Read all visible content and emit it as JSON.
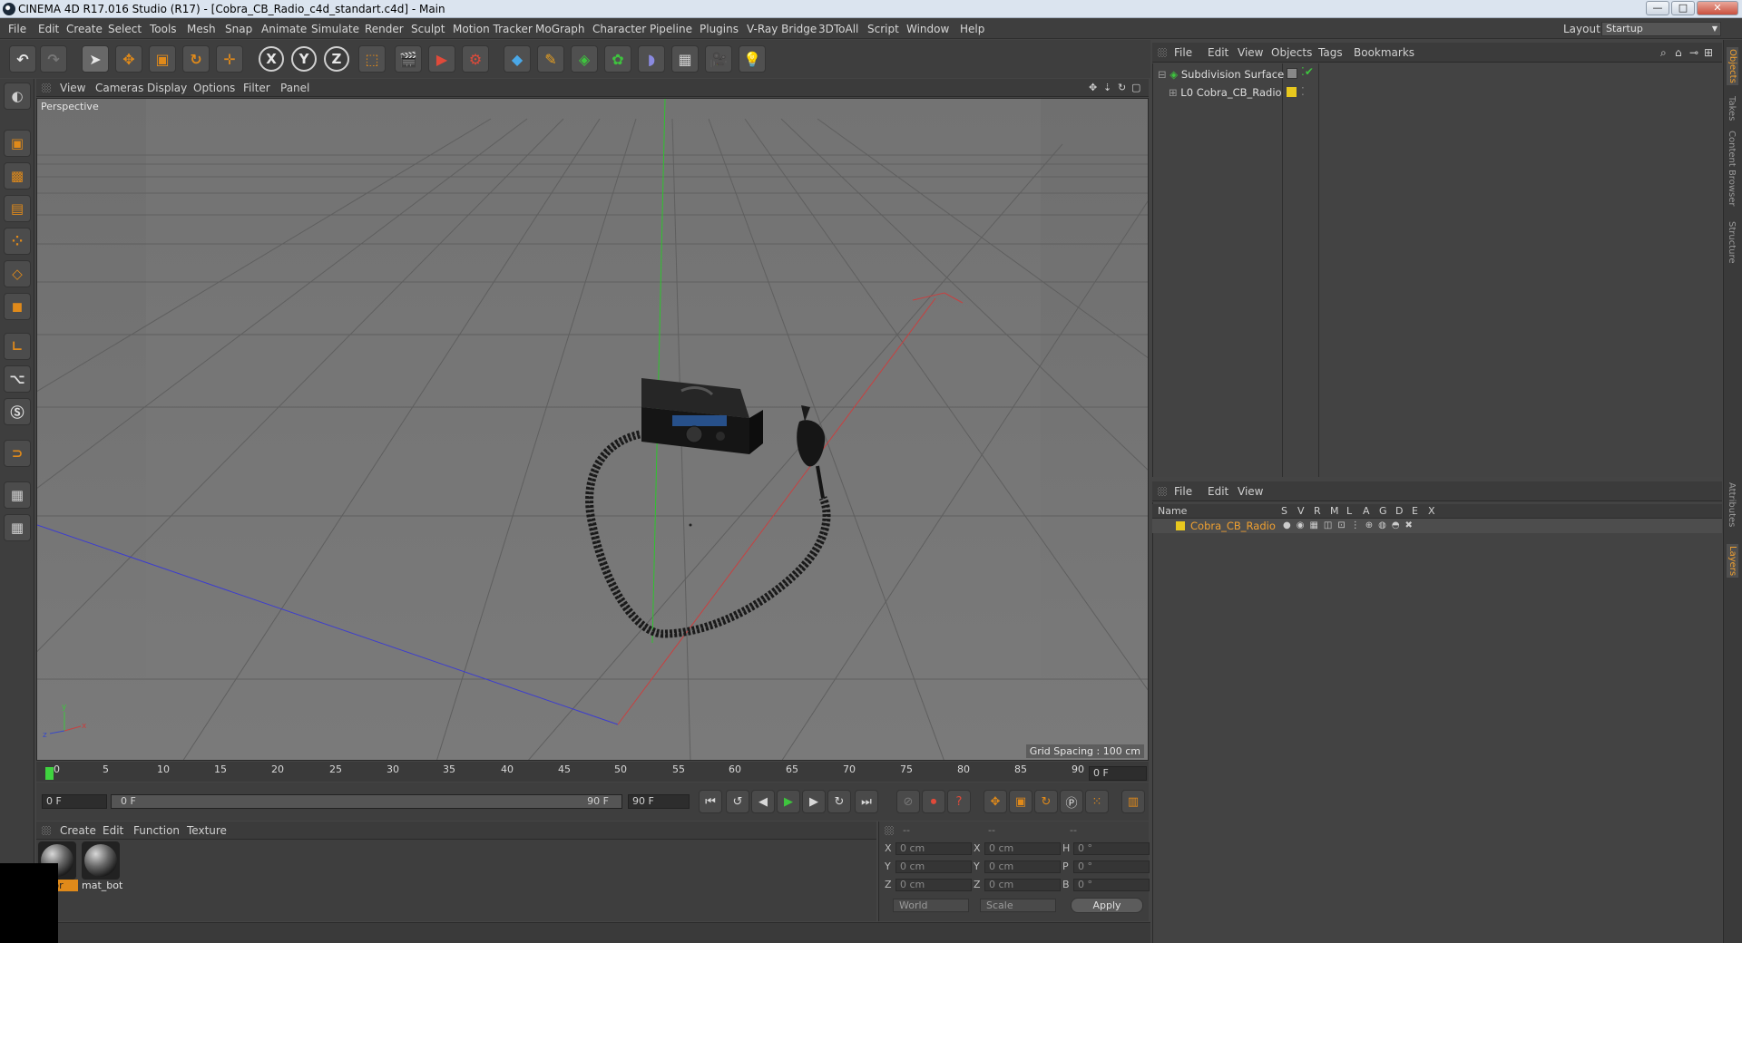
{
  "window": {
    "title": "CINEMA 4D R17.016 Studio (R17) - [Cobra_CB_Radio_c4d_standart.c4d] - Main",
    "minimize": "—",
    "maximize": "□",
    "close": "✕"
  },
  "menubar": {
    "items": [
      "File",
      "Edit",
      "Create",
      "Select",
      "Tools",
      "Mesh",
      "Snap",
      "Animate",
      "Simulate",
      "Render",
      "Sculpt",
      "Motion Tracker",
      "MoGraph",
      "Character",
      "Pipeline",
      "Plugins",
      "V-Ray Bridge",
      "3DToAll",
      "Script",
      "Window",
      "Help"
    ],
    "layout_label": "Layout:",
    "layout_value": "Startup"
  },
  "toolbar": {
    "x_axis": "X",
    "y_axis": "Y",
    "z_axis": "Z"
  },
  "viewport": {
    "menus": [
      "View",
      "Cameras",
      "Display",
      "Options",
      "Filter",
      "Panel"
    ],
    "camera_label": "Perspective",
    "grid_spacing": "Grid Spacing : 100 cm"
  },
  "timeline": {
    "ticks": [
      "0",
      "5",
      "10",
      "15",
      "20",
      "25",
      "30",
      "35",
      "40",
      "45",
      "50",
      "55",
      "60",
      "65",
      "70",
      "75",
      "80",
      "85",
      "90"
    ],
    "current_frame": "0 F"
  },
  "transport": {
    "start_field": "0 F",
    "range_start": "0 F",
    "range_end": "90 F",
    "end_field": "90 F"
  },
  "material_manager": {
    "menus": [
      "Create",
      "Edit",
      "Function",
      "Texture"
    ],
    "materials": [
      {
        "name": "or"
      },
      {
        "name": "mat_bot"
      }
    ]
  },
  "coordinates": {
    "headers": [
      "--",
      "--",
      "--"
    ],
    "rows": [
      {
        "a": "X",
        "av": "0 cm",
        "b": "X",
        "bv": "0 cm",
        "c": "H",
        "cv": "0 °"
      },
      {
        "a": "Y",
        "av": "0 cm",
        "b": "Y",
        "bv": "0 cm",
        "c": "P",
        "cv": "0 °"
      },
      {
        "a": "Z",
        "av": "0 cm",
        "b": "Z",
        "bv": "0 cm",
        "c": "B",
        "cv": "0 °"
      }
    ],
    "mode_select": "World",
    "scale_select": "Scale",
    "apply": "Apply"
  },
  "object_manager": {
    "menus": [
      "File",
      "Edit",
      "View",
      "Objects",
      "Tags",
      "Bookmarks"
    ],
    "objects": [
      {
        "name": "Subdivision Surface"
      },
      {
        "name": "Cobra_CB_Radio"
      }
    ]
  },
  "layer_manager": {
    "menus": [
      "File",
      "Edit",
      "View"
    ],
    "columns": [
      "Name",
      "S",
      "V",
      "R",
      "M",
      "L",
      "A",
      "G",
      "D",
      "E",
      "X"
    ],
    "layers": [
      {
        "name": "Cobra_CB_Radio",
        "color": "#e8c81e"
      }
    ]
  },
  "right_tabs": [
    "Objects",
    "Takes",
    "Content Browser",
    "Structure",
    "Attributes",
    "Layers"
  ],
  "colors": {
    "accent": "#e08a1a",
    "layer_text": "#f0a030",
    "x_axis": "#c84a4a",
    "y_axis": "#3ec43e",
    "z_axis": "#3a4ac8"
  }
}
